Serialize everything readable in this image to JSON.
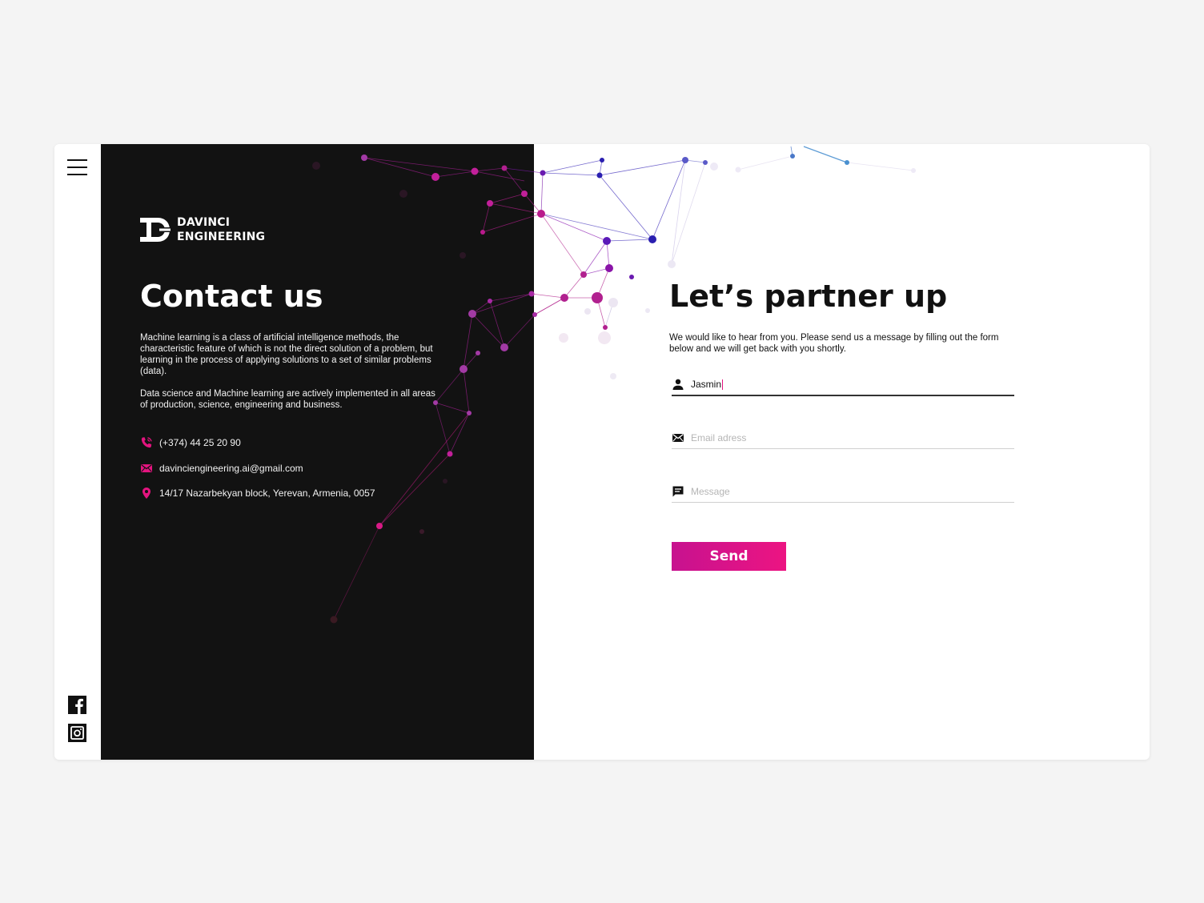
{
  "brand": {
    "line1": "DAVINCI",
    "line2": "ENGINEERING"
  },
  "contact": {
    "title": "Contact us",
    "paragraph1": "Machine learning is a class of artificial intelligence methods, the characteristic feature of which is not the direct solution of a problem, but learning in the process of applying solutions to a set of similar problems (data).",
    "paragraph2": "Data science and Machine learning are actively implemented in all areas of production, science, engineering and business.",
    "phone": "(+374) 44 25 20 90",
    "email": "davinciengineering.ai@gmail.com",
    "address": "14/17 Nazarbekyan block, Yerevan, Armenia, 0057"
  },
  "form": {
    "title": "Let’s partner up",
    "intro": "We would like to hear from you. Please send us a message by filling out the form below and we will get back with you shortly.",
    "name_value": "Jasmin",
    "email_placeholder": "Email adress",
    "message_placeholder": "Message",
    "send_label": "Send"
  },
  "icons": {
    "menu": "hamburger-menu-icon",
    "facebook": "facebook-icon",
    "instagram": "instagram-icon",
    "phone": "phone-icon",
    "email": "envelope-icon",
    "location": "location-pin-icon",
    "user": "user-icon",
    "message": "chat-icon"
  },
  "colors": {
    "dark_panel": "#121212",
    "accent": "#e4147f",
    "accent_dark": "#c7128f",
    "background": "#f4f4f4",
    "network_blue": "#2a1fb0"
  }
}
